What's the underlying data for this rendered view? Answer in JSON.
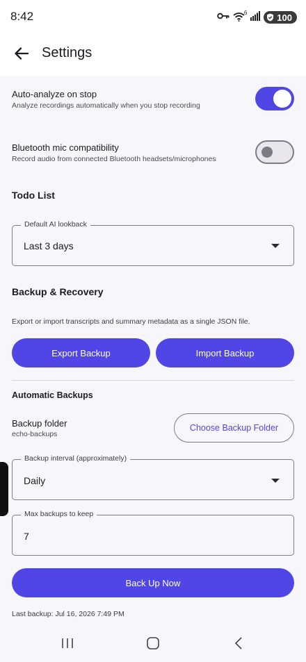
{
  "status_bar": {
    "time": "8:42",
    "wifi_badge": "6",
    "battery": "100",
    "icons": [
      "key-icon",
      "wifi-icon",
      "signal-icon",
      "battery-icon"
    ]
  },
  "app_bar": {
    "title": "Settings",
    "back_icon": "arrow-left-icon"
  },
  "settings": {
    "auto_analyze": {
      "title": "Auto-analyze on stop",
      "subtitle": "Analyze recordings automatically when you stop recording",
      "enabled": true
    },
    "bluetooth": {
      "title": "Bluetooth mic compatibility",
      "subtitle": "Record audio from connected Bluetooth headsets/microphones",
      "enabled": false
    }
  },
  "todo": {
    "heading": "Todo List",
    "lookback_label": "Default AI lookback",
    "lookback_value": "Last 3 days"
  },
  "backup": {
    "heading": "Backup & Recovery",
    "description": "Export or import transcripts and summary metadata as a single JSON file.",
    "export_label": "Export Backup",
    "import_label": "Import Backup"
  },
  "auto_backup": {
    "heading": "Automatic Backups",
    "folder_title": "Backup folder",
    "folder_value": "echo-backups",
    "choose_folder_label": "Choose Backup Folder",
    "interval_label": "Backup interval (approximately)",
    "interval_value": "Daily",
    "max_label": "Max backups to keep",
    "max_value": "7",
    "back_up_now_label": "Back Up Now",
    "last_backup": "Last backup: Jul 16, 2026 7:49 PM"
  },
  "colors": {
    "accent": "#4f46e5",
    "background": "#f7f7fb",
    "outline": "#7c7a86"
  },
  "nav": {
    "recents_icon": "recents-icon",
    "home_icon": "home-icon",
    "back_icon": "back-chevron-icon"
  }
}
